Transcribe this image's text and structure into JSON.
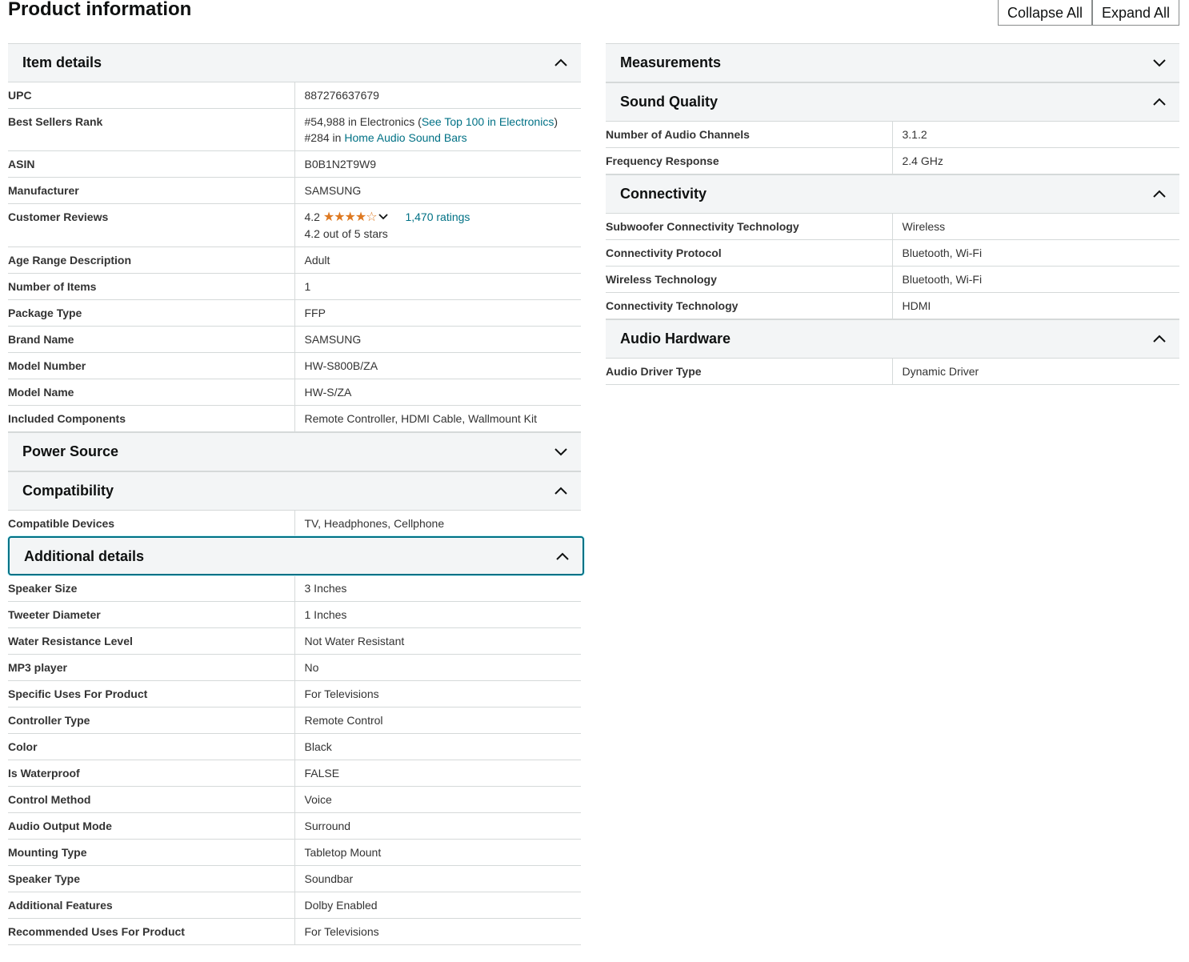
{
  "title": "Product information",
  "buttons": {
    "collapse_all": "Collapse All",
    "expand_all": "Expand All"
  },
  "sections": {
    "item_details": {
      "title": "Item details",
      "rows": {
        "upc": {
          "k": "UPC",
          "v": "887276637679"
        },
        "bsr": {
          "k": "Best Sellers Rank",
          "line1_prefix": "#54,988 in Electronics (",
          "line1_link": "See Top 100 in Electronics",
          "line1_suffix": ")",
          "line2_prefix": "#284 in ",
          "line2_link": "Home Audio Sound Bars"
        },
        "asin": {
          "k": "ASIN",
          "v": "B0B1N2T9W9"
        },
        "manufacturer": {
          "k": "Manufacturer",
          "v": "SAMSUNG"
        },
        "reviews": {
          "k": "Customer Reviews",
          "rating": "4.2",
          "stars": "★★★★☆",
          "ratings_link": "1,470 ratings",
          "out_of": "4.2 out of 5 stars"
        },
        "age": {
          "k": "Age Range Description",
          "v": "Adult"
        },
        "num_items": {
          "k": "Number of Items",
          "v": "1"
        },
        "package": {
          "k": "Package Type",
          "v": "FFP"
        },
        "brand": {
          "k": "Brand Name",
          "v": "SAMSUNG"
        },
        "model_number": {
          "k": "Model Number",
          "v": "HW-S800B/ZA"
        },
        "model_name": {
          "k": "Model Name",
          "v": "HW-S/ZA"
        },
        "components": {
          "k": "Included Components",
          "v": "Remote Controller, HDMI Cable, Wallmount Kit"
        }
      }
    },
    "power_source": {
      "title": "Power Source"
    },
    "compatibility": {
      "title": "Compatibility",
      "rows": {
        "devices": {
          "k": "Compatible Devices",
          "v": "TV, Headphones, Cellphone"
        }
      }
    },
    "additional": {
      "title": "Additional details",
      "rows": [
        {
          "k": "Speaker Size",
          "v": "3 Inches"
        },
        {
          "k": "Tweeter Diameter",
          "v": "1 Inches"
        },
        {
          "k": "Water Resistance Level",
          "v": "Not Water Resistant"
        },
        {
          "k": "MP3 player",
          "v": "No"
        },
        {
          "k": "Specific Uses For Product",
          "v": "For Televisions"
        },
        {
          "k": "Controller Type",
          "v": "Remote Control"
        },
        {
          "k": "Color",
          "v": "Black"
        },
        {
          "k": "Is Waterproof",
          "v": "FALSE"
        },
        {
          "k": "Control Method",
          "v": "Voice"
        },
        {
          "k": "Audio Output Mode",
          "v": "Surround"
        },
        {
          "k": "Mounting Type",
          "v": "Tabletop Mount"
        },
        {
          "k": "Speaker Type",
          "v": "Soundbar"
        },
        {
          "k": "Additional Features",
          "v": "Dolby Enabled"
        },
        {
          "k": "Recommended Uses For Product",
          "v": "For Televisions"
        }
      ]
    },
    "measurements": {
      "title": "Measurements"
    },
    "sound_quality": {
      "title": "Sound Quality",
      "rows": [
        {
          "k": "Number of Audio Channels",
          "v": "3.1.2"
        },
        {
          "k": "Frequency Response",
          "v": "2.4 GHz"
        }
      ]
    },
    "connectivity": {
      "title": "Connectivity",
      "rows": [
        {
          "k": "Subwoofer Connectivity Technology",
          "v": "Wireless"
        },
        {
          "k": "Connectivity Protocol",
          "v": "Bluetooth, Wi-Fi"
        },
        {
          "k": "Wireless Technology",
          "v": "Bluetooth, Wi-Fi"
        },
        {
          "k": "Connectivity Technology",
          "v": "HDMI"
        }
      ]
    },
    "audio_hardware": {
      "title": "Audio Hardware",
      "rows": [
        {
          "k": "Audio Driver Type",
          "v": "Dynamic Driver"
        }
      ]
    }
  },
  "icons": {
    "expanded": "chevron-up-icon",
    "collapsed": "chevron-down-icon"
  },
  "colors": {
    "link": "#007185",
    "star": "#de7921",
    "header_bg": "#f3f5f6",
    "focus": "#007185"
  }
}
